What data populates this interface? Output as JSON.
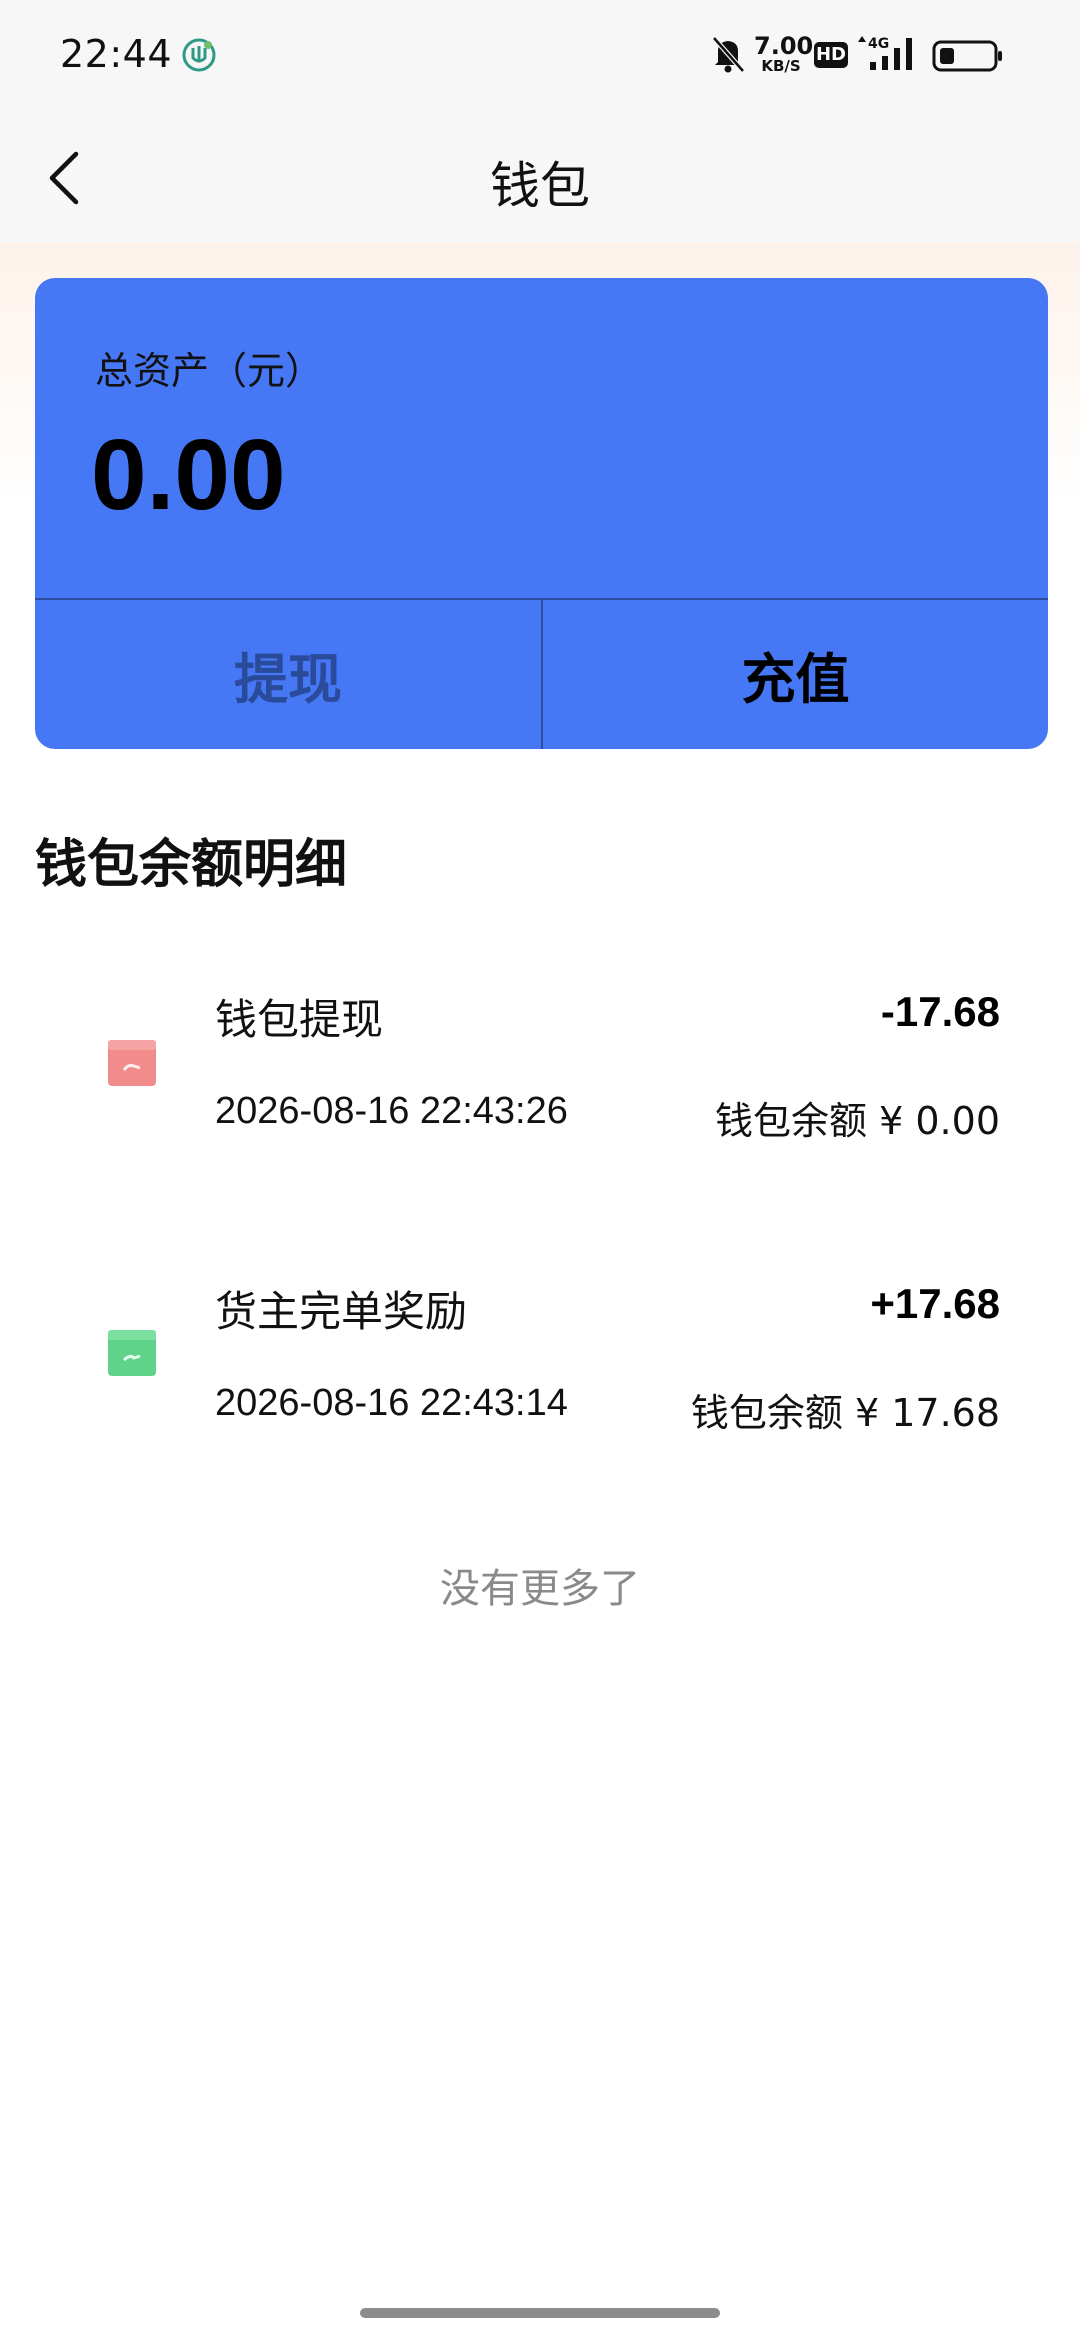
{
  "status_bar": {
    "time": "22:44",
    "net_speed_value": "7.00",
    "net_speed_unit": "KB/S",
    "hd_label": "HD",
    "network_label": "4G",
    "icons": [
      "app-notification-icon",
      "bell-off-icon",
      "signal-icon",
      "battery-icon"
    ]
  },
  "nav": {
    "title": "钱包",
    "back_icon": "chevron-left-icon"
  },
  "wallet_card": {
    "asset_label": "总资产（元）",
    "asset_value": "0.00",
    "withdraw_label": "提现",
    "recharge_label": "充值",
    "card_color": "#4677f5"
  },
  "section": {
    "title": "钱包余额明细"
  },
  "transactions": [
    {
      "title": "钱包提现",
      "amount": "-17.68",
      "time": "2026-08-16 22:43:26",
      "balance": "钱包余额 ¥ 0.00",
      "icon": "withdraw-icon",
      "icon_color": "#f28b8b"
    },
    {
      "title": "货主完单奖励",
      "amount": "+17.68",
      "time": "2026-08-16 22:43:14",
      "balance": "钱包余额 ¥ 17.68",
      "icon": "reward-icon",
      "icon_color": "#5fd38a"
    }
  ],
  "footer": {
    "no_more": "没有更多了"
  }
}
